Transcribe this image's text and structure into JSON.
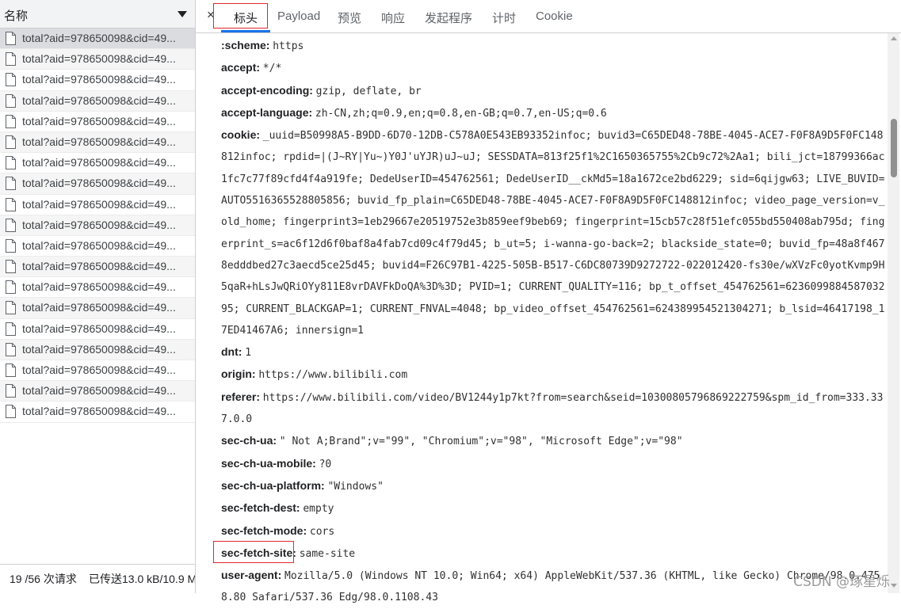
{
  "left": {
    "column_title": "名称",
    "requests": [
      "total?aid=978650098&cid=49...",
      "total?aid=978650098&cid=49...",
      "total?aid=978650098&cid=49...",
      "total?aid=978650098&cid=49...",
      "total?aid=978650098&cid=49...",
      "total?aid=978650098&cid=49...",
      "total?aid=978650098&cid=49...",
      "total?aid=978650098&cid=49...",
      "total?aid=978650098&cid=49...",
      "total?aid=978650098&cid=49...",
      "total?aid=978650098&cid=49...",
      "total?aid=978650098&cid=49...",
      "total?aid=978650098&cid=49...",
      "total?aid=978650098&cid=49...",
      "total?aid=978650098&cid=49...",
      "total?aid=978650098&cid=49...",
      "total?aid=978650098&cid=49...",
      "total?aid=978650098&cid=49...",
      "total?aid=978650098&cid=49..."
    ],
    "status": {
      "requests": "19 /56 次请求",
      "transferred": "已传送13.0 kB/10.9 M"
    }
  },
  "tabs": {
    "close_label": "×",
    "items": [
      "标头",
      "Payload",
      "预览",
      "响应",
      "发起程序",
      "计时",
      "Cookie"
    ]
  },
  "headers": [
    {
      "key": ":scheme:",
      "value": "https"
    },
    {
      "key": "accept:",
      "value": "*/*"
    },
    {
      "key": "accept-encoding:",
      "value": "gzip, deflate, br"
    },
    {
      "key": "accept-language:",
      "value": "zh-CN,zh;q=0.9,en;q=0.8,en-GB;q=0.7,en-US;q=0.6"
    },
    {
      "key": "cookie:",
      "value": "_uuid=B50998A5-B9DD-6D70-12DB-C578A0E543EB93352infoc; buvid3=C65DED48-78BE-4045-ACE7-F0F8A9D5F0FC148812infoc; rpdid=|(J~RY|Yu~)Y0J'uYJR)uJ~uJ; SESSDATA=813f25f1%2C1650365755%2Cb9c72%2Aa1; bili_jct=18799366ac1fc7c77f89cfd4f4a919fe; DedeUserID=454762561; DedeUserID__ckMd5=18a1672ce2bd6229; sid=6qijgw63; LIVE_BUVID=AUTO5516365528805856; buvid_fp_plain=C65DED48-78BE-4045-ACE7-F0F8A9D5F0FC148812infoc; video_page_version=v_old_home; fingerprint3=1eb29667e20519752e3b859eef9beb69; fingerprint=15cb57c28f51efc055bd550408ab795d; fingerprint_s=ac6f12d6f0baf8a4fab7cd09c4f79d45; b_ut=5; i-wanna-go-back=2; blackside_state=0; buvid_fp=48a8f4678edddbed27c3aecd5ce25d45; buvid4=F26C97B1-4225-505B-B517-C6DC80739D9272722-022012420-fs30e/wXVzFc0yotKvmp9H5qaR+hLsJwQRiOYy811E8vrDAVFkDoQA%3D%3D; PVID=1; CURRENT_QUALITY=116; bp_t_offset_454762561=623609988458703295; CURRENT_BLACKGAP=1; CURRENT_FNVAL=4048; bp_video_offset_454762561=624389954521304271; b_lsid=46417198_17ED41467A6; innersign=1"
    },
    {
      "key": "dnt:",
      "value": "1"
    },
    {
      "key": "origin:",
      "value": "https://www.bilibili.com"
    },
    {
      "key": "referer:",
      "value": "https://www.bilibili.com/video/BV1244y1p7kt?from=search&seid=10300805796869222759&spm_id_from=333.337.0.0"
    },
    {
      "key": "sec-ch-ua:",
      "value": "\" Not A;Brand\";v=\"99\", \"Chromium\";v=\"98\", \"Microsoft Edge\";v=\"98\""
    },
    {
      "key": "sec-ch-ua-mobile:",
      "value": "?0"
    },
    {
      "key": "sec-ch-ua-platform:",
      "value": "\"Windows\""
    },
    {
      "key": "sec-fetch-dest:",
      "value": "empty"
    },
    {
      "key": "sec-fetch-mode:",
      "value": "cors"
    },
    {
      "key": "sec-fetch-site:",
      "value": "same-site"
    },
    {
      "key": "user-agent:",
      "value": "Mozilla/5.0 (Windows NT 10.0; Win64; x64) AppleWebKit/537.36 (KHTML, like Gecko) Chrome/98.0.4758.80 Safari/537.36 Edg/98.0.1108.43"
    }
  ],
  "watermark": "CSDN @琢星烁",
  "colors": {
    "highlight": "#e0282d",
    "tab_active_underline": "#1a73e8",
    "selected_row": "#dadce0"
  }
}
